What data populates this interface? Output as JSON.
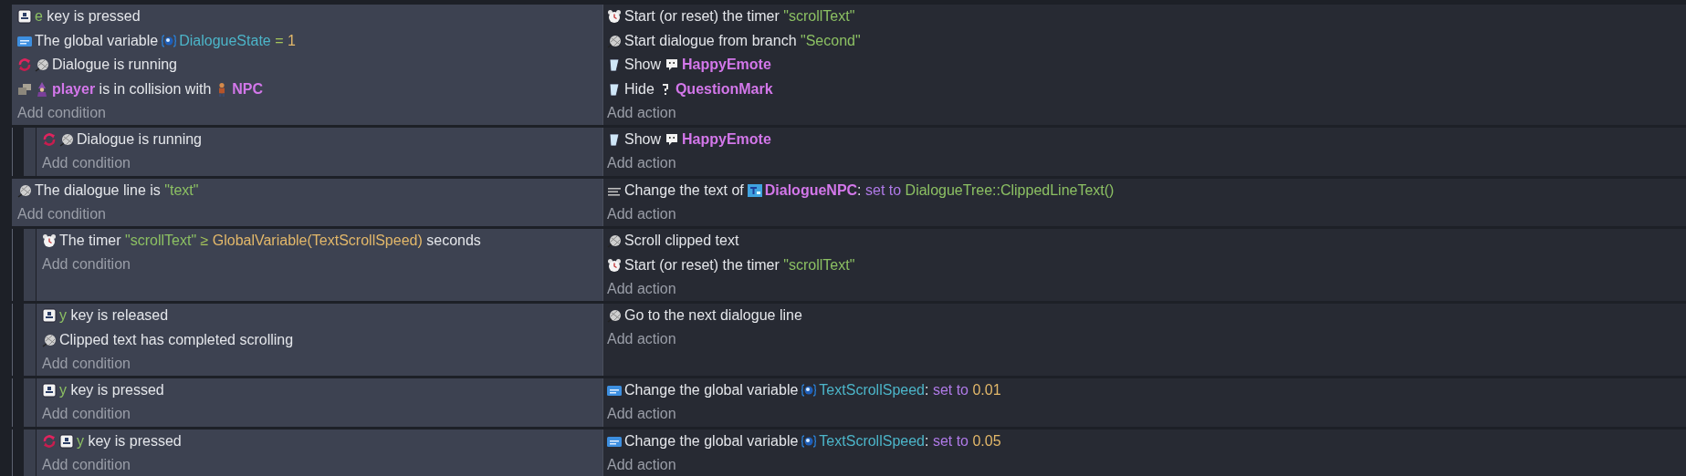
{
  "events": [
    {
      "conditions": [
        {
          "parts": [
            {
              "kind": "keyboard"
            },
            {
              "kind": "text",
              "runs": [
                {
                  "kind": "string",
                  "text": "e"
                },
                {
                  "kind": "plain",
                  "text": " key is pressed"
                }
              ]
            }
          ]
        },
        {
          "parts": [
            {
              "kind": "variable"
            },
            {
              "kind": "text",
              "runs": [
                {
                  "kind": "plain",
                  "text": "The global variable"
                }
              ]
            },
            {
              "kind": "scope"
            },
            {
              "kind": "text",
              "runs": [
                {
                  "kind": "variable",
                  "text": "DialogueState"
                },
                {
                  "kind": "operator",
                  "text": " = "
                },
                {
                  "kind": "number",
                  "text": "1"
                }
              ]
            }
          ]
        },
        {
          "parts": [
            {
              "kind": "trigger"
            },
            {
              "kind": "dialogue"
            },
            {
              "kind": "text",
              "runs": [
                {
                  "kind": "plain",
                  "text": "Dialogue is running"
                }
              ]
            }
          ]
        },
        {
          "parts": [
            {
              "kind": "collision"
            },
            {
              "kind": "player"
            },
            {
              "kind": "text",
              "runs": [
                {
                  "kind": "object",
                  "text": "player"
                },
                {
                  "kind": "plain",
                  "text": " is in collision with"
                }
              ]
            },
            {
              "kind": "npc"
            },
            {
              "kind": "text",
              "runs": [
                {
                  "kind": "object",
                  "text": "NPC"
                }
              ]
            }
          ]
        }
      ],
      "add_condition": "Add condition",
      "actions": [
        {
          "parts": [
            {
              "kind": "timer"
            },
            {
              "kind": "text",
              "runs": [
                {
                  "kind": "plain",
                  "text": "Start (or reset) the timer "
                },
                {
                  "kind": "string",
                  "text": "\"scrollText\""
                }
              ]
            }
          ]
        },
        {
          "parts": [
            {
              "kind": "dialogue"
            },
            {
              "kind": "text",
              "runs": [
                {
                  "kind": "plain",
                  "text": "Start dialogue from branch "
                },
                {
                  "kind": "string",
                  "text": "\"Second\""
                }
              ]
            }
          ]
        },
        {
          "parts": [
            {
              "kind": "visibility"
            },
            {
              "kind": "text",
              "runs": [
                {
                  "kind": "plain",
                  "text": "Show"
                }
              ]
            },
            {
              "kind": "emote"
            },
            {
              "kind": "text",
              "runs": [
                {
                  "kind": "object",
                  "text": "HappyEmote"
                }
              ]
            }
          ]
        },
        {
          "parts": [
            {
              "kind": "visibility"
            },
            {
              "kind": "text",
              "runs": [
                {
                  "kind": "plain",
                  "text": "Hide"
                }
              ]
            },
            {
              "kind": "question"
            },
            {
              "kind": "text",
              "runs": [
                {
                  "kind": "object",
                  "text": "QuestionMark"
                }
              ]
            }
          ]
        }
      ],
      "add_action": "Add action",
      "children": [
        {
          "conditions": [
            {
              "parts": [
                {
                  "kind": "trigger"
                },
                {
                  "kind": "dialogue"
                },
                {
                  "kind": "text",
                  "runs": [
                    {
                      "kind": "plain",
                      "text": "Dialogue is running"
                    }
                  ]
                }
              ]
            }
          ],
          "add_condition": "Add condition",
          "actions": [
            {
              "parts": [
                {
                  "kind": "visibility"
                },
                {
                  "kind": "text",
                  "runs": [
                    {
                      "kind": "plain",
                      "text": "Show"
                    }
                  ]
                },
                {
                  "kind": "emote"
                },
                {
                  "kind": "text",
                  "runs": [
                    {
                      "kind": "object",
                      "text": "HappyEmote"
                    }
                  ]
                }
              ]
            }
          ],
          "add_action": "Add action"
        }
      ]
    },
    {
      "conditions": [
        {
          "parts": [
            {
              "kind": "dialogue"
            },
            {
              "kind": "text",
              "runs": [
                {
                  "kind": "plain",
                  "text": "The dialogue line is "
                },
                {
                  "kind": "string",
                  "text": "\"text\""
                }
              ]
            }
          ]
        }
      ],
      "add_condition": "Add condition",
      "actions": [
        {
          "parts": [
            {
              "kind": "text-action"
            },
            {
              "kind": "text",
              "runs": [
                {
                  "kind": "plain",
                  "text": "Change the text of"
                }
              ]
            },
            {
              "kind": "text-object"
            },
            {
              "kind": "text",
              "runs": [
                {
                  "kind": "object",
                  "text": "DialogueNPC"
                },
                {
                  "kind": "plain",
                  "text": ": "
                },
                {
                  "kind": "keyword",
                  "text": "set to "
                },
                {
                  "kind": "string",
                  "text": "DialogueTree::ClippedLineText()"
                }
              ]
            }
          ]
        }
      ],
      "add_action": "Add action",
      "children": [
        {
          "conditions": [
            {
              "parts": [
                {
                  "kind": "timer"
                },
                {
                  "kind": "text",
                  "runs": [
                    {
                      "kind": "plain",
                      "text": "The timer "
                    },
                    {
                      "kind": "string",
                      "text": "\"scrollText\""
                    },
                    {
                      "kind": "operator",
                      "text": " ≥ "
                    },
                    {
                      "kind": "number",
                      "text": "GlobalVariable(TextScrollSpeed)"
                    },
                    {
                      "kind": "plain",
                      "text": " seconds"
                    }
                  ]
                }
              ]
            }
          ],
          "add_condition": "Add condition",
          "actions": [
            {
              "parts": [
                {
                  "kind": "dialogue"
                },
                {
                  "kind": "text",
                  "runs": [
                    {
                      "kind": "plain",
                      "text": "Scroll clipped text"
                    }
                  ]
                }
              ]
            },
            {
              "parts": [
                {
                  "kind": "timer"
                },
                {
                  "kind": "text",
                  "runs": [
                    {
                      "kind": "plain",
                      "text": "Start (or reset) the timer "
                    },
                    {
                      "kind": "string",
                      "text": "\"scrollText\""
                    }
                  ]
                }
              ]
            }
          ],
          "add_action": "Add action"
        },
        {
          "conditions": [
            {
              "parts": [
                {
                  "kind": "keyboard"
                },
                {
                  "kind": "text",
                  "runs": [
                    {
                      "kind": "string",
                      "text": "y"
                    },
                    {
                      "kind": "plain",
                      "text": " key is released"
                    }
                  ]
                }
              ]
            },
            {
              "parts": [
                {
                  "kind": "dialogue"
                },
                {
                  "kind": "text",
                  "runs": [
                    {
                      "kind": "plain",
                      "text": "Clipped text has completed scrolling"
                    }
                  ]
                }
              ]
            }
          ],
          "add_condition": "Add condition",
          "actions": [
            {
              "parts": [
                {
                  "kind": "dialogue"
                },
                {
                  "kind": "text",
                  "runs": [
                    {
                      "kind": "plain",
                      "text": "Go to the next dialogue line"
                    }
                  ]
                }
              ]
            }
          ],
          "add_action": "Add action"
        },
        {
          "conditions": [
            {
              "parts": [
                {
                  "kind": "keyboard"
                },
                {
                  "kind": "text",
                  "runs": [
                    {
                      "kind": "string",
                      "text": "y"
                    },
                    {
                      "kind": "plain",
                      "text": " key is pressed"
                    }
                  ]
                }
              ]
            }
          ],
          "add_condition": "Add condition",
          "actions": [
            {
              "parts": [
                {
                  "kind": "variable"
                },
                {
                  "kind": "text",
                  "runs": [
                    {
                      "kind": "plain",
                      "text": "Change the global variable"
                    }
                  ]
                },
                {
                  "kind": "scope"
                },
                {
                  "kind": "text",
                  "runs": [
                    {
                      "kind": "variable",
                      "text": "TextScrollSpeed"
                    },
                    {
                      "kind": "plain",
                      "text": ": "
                    },
                    {
                      "kind": "keyword",
                      "text": "set to "
                    },
                    {
                      "kind": "number",
                      "text": "0.01"
                    }
                  ]
                }
              ]
            }
          ],
          "add_action": "Add action"
        },
        {
          "conditions": [
            {
              "parts": [
                {
                  "kind": "trigger"
                },
                {
                  "kind": "keyboard"
                },
                {
                  "kind": "text",
                  "runs": [
                    {
                      "kind": "string",
                      "text": "y"
                    },
                    {
                      "kind": "plain",
                      "text": " key is pressed"
                    }
                  ]
                }
              ]
            }
          ],
          "add_condition": "Add condition",
          "actions": [
            {
              "parts": [
                {
                  "kind": "variable"
                },
                {
                  "kind": "text",
                  "runs": [
                    {
                      "kind": "plain",
                      "text": "Change the global variable"
                    }
                  ]
                },
                {
                  "kind": "scope"
                },
                {
                  "kind": "text",
                  "runs": [
                    {
                      "kind": "variable",
                      "text": "TextScrollSpeed"
                    },
                    {
                      "kind": "plain",
                      "text": ": "
                    },
                    {
                      "kind": "keyword",
                      "text": "set to "
                    },
                    {
                      "kind": "number",
                      "text": "0.05"
                    }
                  ]
                }
              ]
            }
          ],
          "add_action": "Add action"
        }
      ]
    }
  ]
}
